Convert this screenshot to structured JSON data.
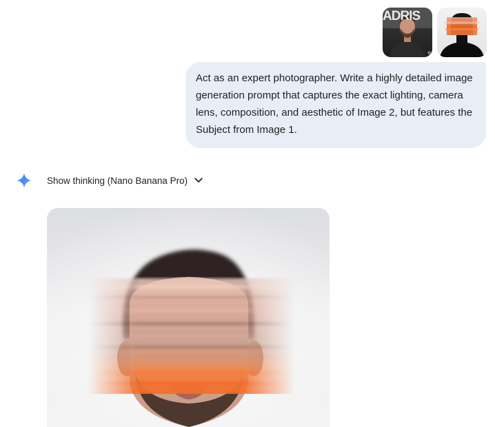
{
  "attachments": [
    {
      "kind": "image",
      "overlay_text": "ADRIS",
      "corner_text": "e"
    },
    {
      "kind": "image"
    }
  ],
  "prompt": {
    "text": "Act as an expert photographer. Write a highly detailed image generation prompt that captures the exact lighting, camera lens, composition, and aesthetic of Image 2, but features the Subject from Image 1."
  },
  "response": {
    "icon": "gemini-sparkle-icon",
    "thinking_label": "Show thinking (Nano Banana Pro)",
    "toggle_icon": "chevron-down-icon"
  },
  "colors": {
    "bubble_bg": "#e9eef6",
    "gemini_blue": "#4285f4",
    "accent_orange": "#f07a33"
  }
}
